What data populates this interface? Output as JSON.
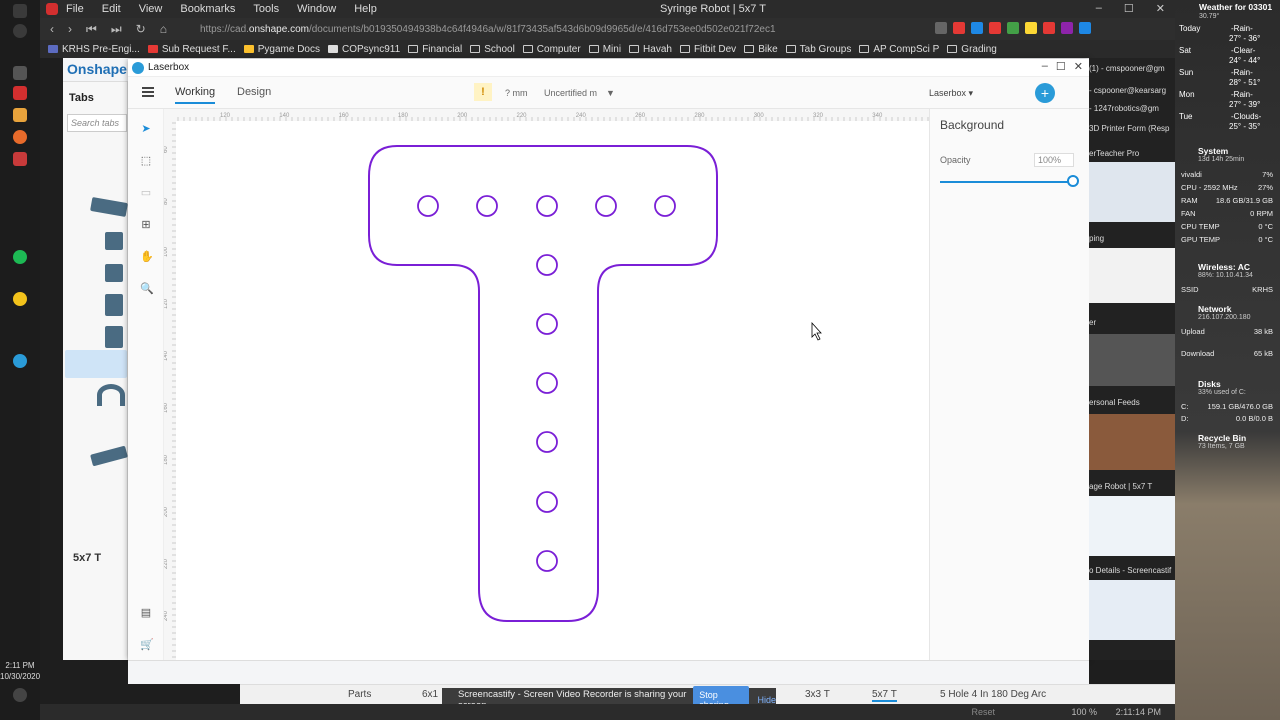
{
  "browser": {
    "menu": [
      "File",
      "Edit",
      "View",
      "Bookmarks",
      "Tools",
      "Window",
      "Help"
    ],
    "window_title": "Syringe Robot | 5x7 T",
    "url_prefix": "https://cad.",
    "url_domain": "onshape.com",
    "url_rest": "/documents/b019350494938b4c64f4946a/w/81f73435af543d6b09d9965d/e/416d753ee0d502e021f72ec1",
    "bookmarks": [
      "KRHS Pre-Engi...",
      "Sub Request F...",
      "Pygame Docs",
      "COPsync911",
      "Financial",
      "School",
      "Computer",
      "Mini",
      "Havah",
      "Fitbit Dev",
      "Bike",
      "Tab Groups",
      "AP CompSci P",
      "Grading"
    ]
  },
  "onshape": {
    "logo": "Onshape",
    "tabs_title": "Tabs",
    "search_placeholder": "Search tabs",
    "active_tab": "5x7 T"
  },
  "laserbox": {
    "title": "Laserbox",
    "tabs": [
      "Working",
      "Design"
    ],
    "warning": "!",
    "thickness": "? mm",
    "material": "Uncertified m",
    "project": "Laserbox",
    "plus": "+",
    "panel_title": "Background",
    "opacity_label": "Opacity",
    "opacity_value": "100%",
    "opacity_level": 1.0,
    "ruler_top": [
      "120",
      "140",
      "160",
      "180",
      "200",
      "220",
      "240",
      "260",
      "280",
      "300",
      "320",
      "340",
      "360"
    ],
    "ruler_left": [
      "60",
      "80",
      "100",
      "120",
      "140",
      "160",
      "180",
      "200",
      "220",
      "240"
    ],
    "outline_color": "#7a1fd6"
  },
  "bottom_tabs": [
    "Parts",
    "6x1",
    "3x3 T",
    "5x7 T",
    "5 Hole 4 In 180 Deg Arc"
  ],
  "share_bar": {
    "message": "Screencastify - Screen Video Recorder is sharing your screen.",
    "stop": "Stop sharing",
    "hide": "Hide"
  },
  "status": {
    "reset": "Reset",
    "zoom": "100 %",
    "clock": "2:11:14 PM"
  },
  "taskbar_clock": {
    "time": "2:11 PM",
    "date": "10/30/2020"
  },
  "desktop": {
    "weather_title": "Weather for 03301",
    "weather_temp": "30.79°",
    "forecast": [
      {
        "day": "Today",
        "cond": "-Rain-",
        "range": "27° - 36°"
      },
      {
        "day": "Sat",
        "cond": "-Clear-",
        "range": "24° - 44°"
      },
      {
        "day": "Sun",
        "cond": "-Rain-",
        "range": "28° - 51°"
      },
      {
        "day": "Mon",
        "cond": "-Rain-",
        "range": "27° - 39°"
      },
      {
        "day": "Tue",
        "cond": "-Clouds-",
        "range": "25° - 35°"
      }
    ],
    "system_title": "System",
    "system_uptime": "13d 14h 25min",
    "system_rows": [
      {
        "k": "vivaldi",
        "v": "7%"
      },
      {
        "k": "CPU - 2592 MHz",
        "v": "27%"
      },
      {
        "k": "RAM",
        "v": "18.6 GB/31.9 GB"
      },
      {
        "k": "FAN",
        "v": "0 RPM"
      },
      {
        "k": "CPU TEMP",
        "v": "0 °C"
      },
      {
        "k": "GPU TEMP",
        "v": "0 °C"
      }
    ],
    "wifi_title": "Wireless: AC",
    "wifi_sub": "88%: 10.10.41.34",
    "ssid_label": "SSID",
    "ssid_value": "KRHS",
    "network_title": "Network",
    "network_ip": "216.107.200.180",
    "upload_label": "Upload",
    "upload_value": "38 kB",
    "download_label": "Download",
    "download_value": "65 kB",
    "disks_title": "Disks",
    "disks_sub": "33% used of C:",
    "disk_c": "C:",
    "disk_c_val": "159.1 GB/476.0 GB",
    "disk_d": "D:",
    "disk_d_val": "0.0 B/0.0 B",
    "bin_title": "Recycle Bin",
    "bin_sub": "73 Items, 7 GB"
  },
  "previews": [
    "(1) - cmspooner@gm",
    "- cspooner@kearsarg",
    "- 1247robotics@gm",
    "3D Printer Form (Resp",
    "erTeacher Pro",
    "ping",
    "er",
    "ersonal Feeds",
    "age Robot | 5x7 T",
    "o Details - Screencastif"
  ]
}
